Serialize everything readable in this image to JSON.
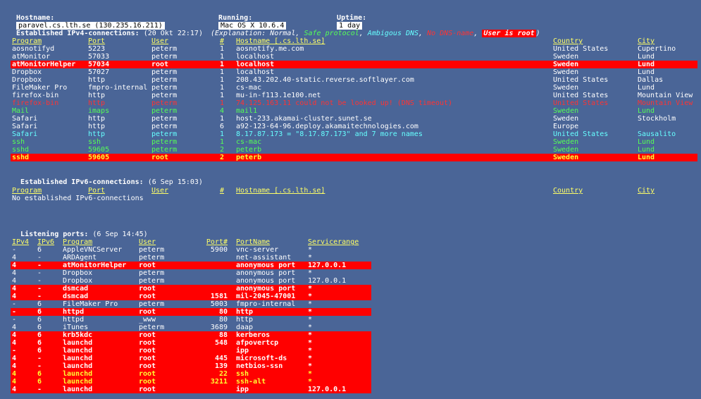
{
  "topbar": {
    "hostname_label": "Hostname:",
    "hostname_value": "paravel.cs.lth.se (130.235.16.211)",
    "running_label": "Running:",
    "running_value": "Mac OS X 10.6.4",
    "uptime_label": "Uptime:",
    "uptime_value": "1 day"
  },
  "ipv4": {
    "title": "Established IPv4-connections:",
    "timestamp": "(20 Okt 22:17)",
    "explanation": {
      "prefix": "(Explanation: ",
      "normal": "Normal",
      "sep1": ", ",
      "safe": "Safe protocol",
      "sep2": ", ",
      "ambig": "Ambigous DNS",
      "sep3": ", ",
      "nodns": "No DNS-name",
      "sep4": ", ",
      "root": "User is root",
      "suffix": ")"
    },
    "headers": [
      "Program",
      "Port",
      "User",
      "#",
      "Hostname [.cs.lth.se]",
      "Country",
      "City"
    ],
    "rows": [
      {
        "style": "normal",
        "cells": [
          "aosnotifyd",
          "5223",
          "peterm",
          "1",
          "aosnotify.me.com",
          "United States",
          "Cupertino"
        ]
      },
      {
        "style": "normal",
        "cells": [
          "atMonitor",
          "57033",
          "peterm",
          "1",
          "localhost",
          "Sweden",
          "Lund"
        ]
      },
      {
        "style": "root",
        "cells": [
          "atMonitorHelper",
          "57034",
          "root",
          "1",
          "localhost",
          "Sweden",
          "Lund"
        ]
      },
      {
        "style": "normal",
        "cells": [
          "Dropbox",
          "57027",
          "peterm",
          "1",
          "localhost",
          "Sweden",
          "Lund"
        ]
      },
      {
        "style": "normal",
        "cells": [
          "Dropbox",
          "http",
          "peterm",
          "1",
          "208.43.202.40-static.reverse.softlayer.com",
          "United States",
          "Dallas"
        ]
      },
      {
        "style": "normal",
        "cells": [
          "FileMaker Pro",
          "fmpro-internal",
          "peterm",
          "1",
          "cs-mac",
          "Sweden",
          "Lund"
        ]
      },
      {
        "style": "normal",
        "cells": [
          "firefox-bin",
          "http",
          "peterm",
          "1",
          "mu-in-f113.1e100.net",
          "United States",
          "Mountain View"
        ]
      },
      {
        "style": "nodns",
        "cells": [
          "firefox-bin",
          "http",
          "peterm",
          "1",
          "74.125.163.11 could not be looked up! (DNS timeout)",
          "United States",
          "Mountain View"
        ]
      },
      {
        "style": "safe",
        "cells": [
          "Mail",
          "imaps",
          "peterm",
          "4",
          "mail1",
          "Sweden",
          "Lund"
        ]
      },
      {
        "style": "normal",
        "cells": [
          "Safari",
          "http",
          "peterm",
          "1",
          "host-233.akamai-cluster.sunet.se",
          "Sweden",
          "Stockholm"
        ]
      },
      {
        "style": "normal",
        "cells": [
          "Safari",
          "http",
          "peterm",
          "6",
          "a92-123-64-96.deploy.akamaitechnologies.com",
          "Europe",
          ""
        ]
      },
      {
        "style": "ambig",
        "cells": [
          "Safari",
          "http",
          "peterm",
          "1",
          "8.17.87.173 = \"8.17.87.173\" and 7 more names",
          "United States",
          "Sausalito"
        ]
      },
      {
        "style": "safe",
        "cells": [
          "ssh",
          "ssh",
          "peterm",
          "1",
          "cs-mac",
          "Sweden",
          "Lund"
        ]
      },
      {
        "style": "safe",
        "cells": [
          "sshd",
          "59605",
          "peterm",
          "2",
          "peterb",
          "Sweden",
          "Lund"
        ]
      },
      {
        "style": "rootsafe",
        "cells": [
          "sshd",
          "59605",
          "root",
          "2",
          "peterb",
          "Sweden",
          "Lund"
        ]
      }
    ]
  },
  "ipv6": {
    "title": "Established IPv6-connections:",
    "timestamp": "(6 Sep 15:03)",
    "headers": [
      "Program",
      "Port",
      "User",
      "#",
      "Hostname [.cs.lth.se]",
      "Country",
      "City"
    ],
    "empty_message": "No established IPv6-connections"
  },
  "listening": {
    "title": "Listening ports:",
    "timestamp": "(6 Sep 14:45)",
    "headers": [
      "IPv4",
      "IPv6",
      "Program",
      "User",
      "Port#",
      "PortName",
      "Servicerange"
    ],
    "rows": [
      {
        "style": "normal",
        "cells": [
          "-",
          "6",
          "AppleVNCServer",
          "peterm",
          "5900",
          "vnc-server",
          "*"
        ]
      },
      {
        "style": "normal",
        "cells": [
          "4",
          "-",
          "ARDAgent",
          "peterm",
          "",
          "net-assistant",
          "*"
        ]
      },
      {
        "style": "root",
        "cells": [
          "4",
          "-",
          "atMonitorHelper",
          "root",
          "",
          "anonymous port",
          "127.0.0.1"
        ]
      },
      {
        "style": "normal",
        "cells": [
          "4",
          "-",
          "Dropbox",
          "peterm",
          "",
          "anonymous port",
          "*"
        ]
      },
      {
        "style": "normal",
        "cells": [
          "4",
          "-",
          "Dropbox",
          "peterm",
          "",
          "anonymous port",
          "127.0.0.1"
        ]
      },
      {
        "style": "root",
        "cells": [
          "4",
          "-",
          "dsmcad",
          "root",
          "",
          "anonymous port",
          "*"
        ]
      },
      {
        "style": "root",
        "cells": [
          "4",
          "-",
          "dsmcad",
          "root",
          "1581",
          "mil-2045-47001",
          "*"
        ]
      },
      {
        "style": "normal",
        "cells": [
          "-",
          "6",
          "FileMaker Pro",
          "peterm",
          "5003",
          "fmpro-internal",
          "*"
        ]
      },
      {
        "style": "root",
        "cells": [
          "-",
          "6",
          "httpd",
          "root",
          "80",
          "http",
          "*"
        ]
      },
      {
        "style": "normal",
        "cells": [
          "-",
          "6",
          "httpd",
          "_www",
          "80",
          "http",
          "*"
        ]
      },
      {
        "style": "normal",
        "cells": [
          "4",
          "6",
          "iTunes",
          "peterm",
          "3689",
          "daap",
          "*"
        ]
      },
      {
        "style": "root",
        "cells": [
          "4",
          "6",
          "krb5kdc",
          "root",
          "88",
          "kerberos",
          "*"
        ]
      },
      {
        "style": "root",
        "cells": [
          "4",
          "6",
          "launchd",
          "root",
          "548",
          "afpovertcp",
          "*"
        ]
      },
      {
        "style": "root",
        "cells": [
          "-",
          "6",
          "launchd",
          "root",
          "",
          "ipp",
          "*"
        ]
      },
      {
        "style": "root",
        "cells": [
          "4",
          "-",
          "launchd",
          "root",
          "445",
          "microsoft-ds",
          "*"
        ]
      },
      {
        "style": "root",
        "cells": [
          "4",
          "-",
          "launchd",
          "root",
          "139",
          "netbios-ssn",
          "*"
        ]
      },
      {
        "style": "rootsafe",
        "cells": [
          "4",
          "6",
          "launchd",
          "root",
          "22",
          "ssh",
          "*"
        ]
      },
      {
        "style": "rootsafe",
        "cells": [
          "4",
          "6",
          "launchd",
          "root",
          "3211",
          "ssh-alt",
          "*"
        ]
      },
      {
        "style": "root",
        "cells": [
          "4",
          "-",
          "launchd",
          "root",
          "",
          "ipp",
          "127.0.0.1"
        ]
      }
    ]
  },
  "colors": {
    "background": "#4a6597",
    "header": "#ffff66",
    "safe": "#55ff55",
    "ambiguous": "#66ffff",
    "no_dns": "#ff3333",
    "root_bg": "#ff0000"
  }
}
